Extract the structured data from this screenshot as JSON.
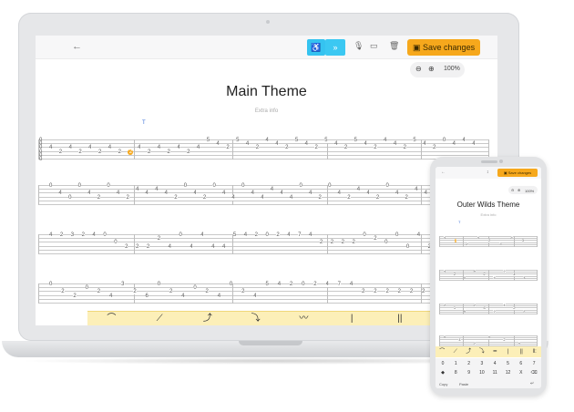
{
  "laptop": {
    "toolbar": {
      "back_icon": "←",
      "tool1_icon": "♿",
      "tool2_label": "»",
      "mic_icon": "🎙",
      "panel_icon": "▭",
      "trash_icon": "🗑",
      "save_icon": "▣",
      "save_label": "Save changes",
      "accent": "#35c3f0",
      "save_color": "#f6a81c"
    },
    "zoom": {
      "out_icon": "⊖",
      "in_icon": "⊕",
      "value": "100%"
    },
    "title": "Main Theme",
    "subtitle": "Extra info",
    "tempo_marker": "T",
    "tab_prefix": [
      "0",
      "0",
      "0",
      "0",
      "0",
      "0"
    ],
    "rows": [
      {
        "notes": [
          {
            "s": 3,
            "t": "4"
          },
          {
            "s": 4,
            "t": "2"
          },
          {
            "s": 3,
            "t": "4"
          },
          {
            "s": 4,
            "t": "2"
          },
          {
            "s": 3,
            "t": "4"
          },
          {
            "s": 4,
            "t": "2"
          },
          {
            "s": 3,
            "t": "4"
          },
          {
            "s": 4,
            "t": "2"
          },
          {
            "s": 4,
            "t": "2",
            "hl": true
          },
          {
            "s": 3,
            "t": "4"
          },
          {
            "s": 4,
            "t": "2"
          },
          {
            "s": 3,
            "t": "4"
          },
          {
            "s": 4,
            "t": "2"
          },
          {
            "s": 3,
            "t": "4"
          },
          {
            "s": 4,
            "t": "2"
          },
          {
            "s": 3,
            "t": "4"
          },
          {
            "s": 1,
            "t": "5"
          },
          {
            "s": 2,
            "t": "4"
          },
          {
            "s": 3,
            "t": "2"
          },
          {
            "s": 1,
            "t": "5"
          },
          {
            "s": 2,
            "t": "4"
          },
          {
            "s": 3,
            "t": "2"
          },
          {
            "s": 1,
            "t": "4"
          },
          {
            "s": 2,
            "t": "4"
          },
          {
            "s": 3,
            "t": "2"
          },
          {
            "s": 1,
            "t": "5"
          },
          {
            "s": 2,
            "t": "4"
          },
          {
            "s": 3,
            "t": "2"
          },
          {
            "s": 1,
            "t": "5"
          },
          {
            "s": 2,
            "t": "4"
          },
          {
            "s": 3,
            "t": "2"
          },
          {
            "s": 1,
            "t": "5"
          },
          {
            "s": 2,
            "t": "4"
          },
          {
            "s": 3,
            "t": "2"
          },
          {
            "s": 1,
            "t": "4"
          },
          {
            "s": 2,
            "t": "4"
          },
          {
            "s": 3,
            "t": "2"
          },
          {
            "s": 1,
            "t": "5"
          },
          {
            "s": 2,
            "t": "4"
          },
          {
            "s": 3,
            "t": "2"
          },
          {
            "s": 1,
            "t": "0"
          },
          {
            "s": 2,
            "t": "4"
          },
          {
            "s": 1,
            "t": "4"
          },
          {
            "s": 2,
            "t": "4"
          }
        ]
      },
      {
        "notes": [
          {
            "s": 1,
            "t": "0"
          },
          {
            "s": 3,
            "t": "4"
          },
          {
            "s": 4,
            "t": "0"
          },
          {
            "s": 1,
            "t": "0"
          },
          {
            "s": 3,
            "t": "4"
          },
          {
            "s": 4,
            "t": "2"
          },
          {
            "s": 1,
            "t": "0"
          },
          {
            "s": 3,
            "t": "4"
          },
          {
            "s": 4,
            "t": "2"
          },
          {
            "s": 2,
            "t": "4"
          },
          {
            "s": 3,
            "t": "4"
          },
          {
            "s": 2,
            "t": "4"
          },
          {
            "s": 3,
            "t": "4"
          },
          {
            "s": 4,
            "t": "2"
          },
          {
            "s": 1,
            "t": "0"
          },
          {
            "s": 3,
            "t": "4"
          },
          {
            "s": 4,
            "t": "2"
          },
          {
            "s": 1,
            "t": "0"
          },
          {
            "s": 3,
            "t": "4"
          },
          {
            "s": 4,
            "t": "4"
          },
          {
            "s": 1,
            "t": "0"
          },
          {
            "s": 3,
            "t": "4"
          },
          {
            "s": 4,
            "t": "4"
          },
          {
            "s": 2,
            "t": "4"
          },
          {
            "s": 3,
            "t": "4"
          },
          {
            "s": 4,
            "t": "4"
          },
          {
            "s": 1,
            "t": "0"
          },
          {
            "s": 3,
            "t": "4"
          },
          {
            "s": 4,
            "t": "2"
          },
          {
            "s": 1,
            "t": "0"
          },
          {
            "s": 3,
            "t": "4"
          },
          {
            "s": 4,
            "t": "2"
          },
          {
            "s": 2,
            "t": "4"
          },
          {
            "s": 3,
            "t": "4"
          },
          {
            "s": 4,
            "t": "2"
          },
          {
            "s": 1,
            "t": "0"
          },
          {
            "s": 3,
            "t": "4"
          },
          {
            "s": 4,
            "t": "2"
          },
          {
            "s": 2,
            "t": "4"
          },
          {
            "s": 3,
            "t": "4"
          },
          {
            "s": 4,
            "t": "0"
          },
          {
            "s": 1,
            "t": "0"
          },
          {
            "s": 4,
            "t": "0"
          },
          {
            "s": 1,
            "t": "4"
          },
          {
            "s": 2,
            "t": "4"
          }
        ]
      },
      {
        "notes": [
          {
            "s": 1,
            "t": "4"
          },
          {
            "s": 1,
            "t": "2"
          },
          {
            "s": 1,
            "t": "3"
          },
          {
            "s": 1,
            "t": "2"
          },
          {
            "s": 1,
            "t": "4"
          },
          {
            "s": 1,
            "t": "0"
          },
          {
            "s": 3,
            "t": "0"
          },
          {
            "s": 4,
            "t": "2"
          },
          {
            "s": 4,
            "t": "2"
          },
          {
            "s": 4,
            "t": "2"
          },
          {
            "s": 2,
            "t": "2"
          },
          {
            "s": 4,
            "t": "4"
          },
          {
            "s": 1,
            "t": "0"
          },
          {
            "s": 4,
            "t": "4"
          },
          {
            "s": 1,
            "t": "4"
          },
          {
            "s": 4,
            "t": "4"
          },
          {
            "s": 4,
            "t": "4"
          },
          {
            "s": 1,
            "t": "5"
          },
          {
            "s": 1,
            "t": "4"
          },
          {
            "s": 1,
            "t": "2"
          },
          {
            "s": 1,
            "t": "0"
          },
          {
            "s": 1,
            "t": "2"
          },
          {
            "s": 1,
            "t": "4"
          },
          {
            "s": 1,
            "t": "7"
          },
          {
            "s": 1,
            "t": "4"
          },
          {
            "s": 3,
            "t": "2"
          },
          {
            "s": 3,
            "t": "2"
          },
          {
            "s": 3,
            "t": "2"
          },
          {
            "s": 3,
            "t": "2"
          },
          {
            "s": 1,
            "t": "0"
          },
          {
            "s": 2,
            "t": "2"
          },
          {
            "s": 3,
            "t": "0"
          },
          {
            "s": 1,
            "t": "0"
          },
          {
            "s": 4,
            "t": "0"
          },
          {
            "s": 1,
            "t": "4"
          },
          {
            "s": 4,
            "t": "2"
          },
          {
            "s": 1,
            "t": "0"
          },
          {
            "s": 4,
            "t": "0"
          },
          {
            "s": 1,
            "t": "5"
          },
          {
            "s": 4,
            "t": "2"
          }
        ]
      },
      {
        "notes": [
          {
            "s": 1,
            "t": "0"
          },
          {
            "s": 3,
            "t": "2"
          },
          {
            "s": 4,
            "t": "2"
          },
          {
            "s": 2,
            "t": "0"
          },
          {
            "s": 3,
            "t": "2"
          },
          {
            "s": 4,
            "t": "4"
          },
          {
            "s": 1,
            "t": "3"
          },
          {
            "s": 3,
            "t": "2"
          },
          {
            "s": 4,
            "t": "6"
          },
          {
            "s": 1,
            "t": "0"
          },
          {
            "s": 3,
            "t": "2"
          },
          {
            "s": 4,
            "t": "4"
          },
          {
            "s": 2,
            "t": "0"
          },
          {
            "s": 3,
            "t": "2"
          },
          {
            "s": 4,
            "t": "4"
          },
          {
            "s": 1,
            "t": "0"
          },
          {
            "s": 3,
            "t": "2"
          },
          {
            "s": 4,
            "t": "4"
          },
          {
            "s": 1,
            "t": "5"
          },
          {
            "s": 1,
            "t": "4"
          },
          {
            "s": 1,
            "t": "2"
          },
          {
            "s": 1,
            "t": "0"
          },
          {
            "s": 1,
            "t": "2"
          },
          {
            "s": 1,
            "t": "4"
          },
          {
            "s": 1,
            "t": "7"
          },
          {
            "s": 1,
            "t": "4"
          },
          {
            "s": 3,
            "t": "2"
          },
          {
            "s": 3,
            "t": "2"
          },
          {
            "s": 3,
            "t": "2"
          },
          {
            "s": 3,
            "t": "2"
          },
          {
            "s": 3,
            "t": "2"
          },
          {
            "s": 3,
            "t": "2"
          },
          {
            "s": 3,
            "t": "2"
          },
          {
            "s": 3,
            "t": "2"
          },
          {
            "s": 3,
            "t": "2"
          },
          {
            "s": 3,
            "t": "2"
          }
        ]
      }
    ],
    "palette": [
      {
        "name": "slur",
        "glyph": "⌒"
      },
      {
        "name": "slide",
        "glyph": "⟋"
      },
      {
        "name": "bend",
        "glyph": "⤴"
      },
      {
        "name": "release",
        "glyph": "⤵"
      },
      {
        "name": "vibrato",
        "glyph": "〰"
      },
      {
        "name": "bar-line",
        "glyph": "|"
      },
      {
        "name": "double-bar",
        "glyph": "||"
      },
      {
        "name": "repeat-start",
        "glyph": "‖:"
      }
    ]
  },
  "phone": {
    "toolbar": {
      "back_icon": "←",
      "tool_icon": "↕",
      "save_icon": "▣",
      "save_label": "Save changes"
    },
    "zoom": {
      "out_icon": "⊖",
      "in_icon": "⊕",
      "value": "100%"
    },
    "title": "Outer Wilds Theme",
    "subtitle": "Extra info",
    "tempo_marker": "T",
    "palette": [
      "⌒",
      "⟋",
      "⤴",
      "⤵",
      "━",
      "|",
      "||",
      "‖:"
    ],
    "keys_row1": [
      "0",
      "1",
      "2",
      "3",
      "4",
      "5",
      "6",
      "7"
    ],
    "keys_row2": [
      "◆",
      "8",
      "9",
      "10",
      "11",
      "12",
      "X",
      "⌫"
    ],
    "copy_label": "Copy",
    "paste_label": "Paste",
    "enter_icon": "↵"
  }
}
